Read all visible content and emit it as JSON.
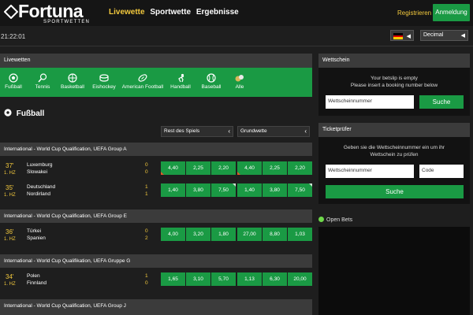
{
  "header": {
    "logo_word": "Fortuna",
    "logo_sub": "SPORTWETTEN",
    "nav": [
      "Livewette",
      "Sportwette",
      "Ergebnisse"
    ],
    "register_label": "Registrieren",
    "login_label": "Anmeldung",
    "time": "21:22:01",
    "odds_format": "Decimal",
    "colors": {
      "accent_green": "#1a9a44",
      "accent_yellow": "#f3c93d"
    }
  },
  "livewetten": {
    "title": "Livewetten",
    "sports": [
      {
        "label": "Fußball",
        "icon": "soccer-ball-icon"
      },
      {
        "label": "Tennis",
        "icon": "tennis-icon"
      },
      {
        "label": "Basketball",
        "icon": "basketball-icon"
      },
      {
        "label": "Eishockey",
        "icon": "hockey-puck-icon"
      },
      {
        "label": "American Football",
        "icon": "american-football-icon"
      },
      {
        "label": "Handball",
        "icon": "handball-icon"
      },
      {
        "label": "Baseball",
        "icon": "baseball-icon"
      },
      {
        "label": "Alle",
        "icon": "all-sports-icon"
      }
    ]
  },
  "section": {
    "title": "Fußball",
    "col_rest": "Rest des Spiels",
    "col_main": "Grundwette"
  },
  "groups": [
    {
      "name": "International - World Cup Qualification, UEFA Group A",
      "matches": [
        {
          "minute": "37'",
          "half": "1. HZ",
          "home": "Luxemburg",
          "away": "Slowakei",
          "score_home": "0",
          "score_away": "0",
          "rest": [
            "4,40",
            "2,25",
            "2,20"
          ],
          "main": [
            "4,40",
            "2,25",
            "2,20"
          ]
        },
        {
          "minute": "35'",
          "half": "1. HZ",
          "home": "Deutschland",
          "away": "Nordirland",
          "score_home": "1",
          "score_away": "1",
          "rest": [
            "1,40",
            "3,80",
            "7,50"
          ],
          "main": [
            "1,40",
            "3,80",
            "7,50"
          ]
        }
      ]
    },
    {
      "name": "International - World Cup Qualification, UEFA Group E",
      "matches": [
        {
          "minute": "36'",
          "half": "1. HZ",
          "home": "Türkei",
          "away": "Spanien",
          "score_home": "0",
          "score_away": "2",
          "rest": [
            "4,00",
            "3,20",
            "1,80"
          ],
          "main": [
            "27,00",
            "8,80",
            "1,03"
          ]
        }
      ]
    },
    {
      "name": "International - World Cup Qualifikation, UEFA Gruppe G",
      "matches": [
        {
          "minute": "34'",
          "half": "1. HZ",
          "home": "Polen",
          "away": "Finnland",
          "score_home": "1",
          "score_away": "0",
          "rest": [
            "1,65",
            "3,10",
            "5,70"
          ],
          "main": [
            "1,13",
            "6,30",
            "20,00"
          ]
        }
      ]
    },
    {
      "name": "International - World Cup Qualification, UEFA Group J",
      "matches": []
    }
  ],
  "betslip": {
    "title": "Wettschein",
    "empty_line1": "Your betslip is empty",
    "empty_line2": "Please insert a booking number below",
    "input_placeholder": "Wettscheinnummer",
    "search_label": "Suche"
  },
  "ticketcheck": {
    "title": "Ticketprüfer",
    "text_line1": "Geben sie die Wettscheinnummer ein um ihr",
    "text_line2": "Wettschein zu prüfen",
    "number_placeholder": "Wettscheinnummer",
    "code_placeholder": "Code",
    "search_label": "Suche"
  },
  "open_bets_label": "Open Bets"
}
